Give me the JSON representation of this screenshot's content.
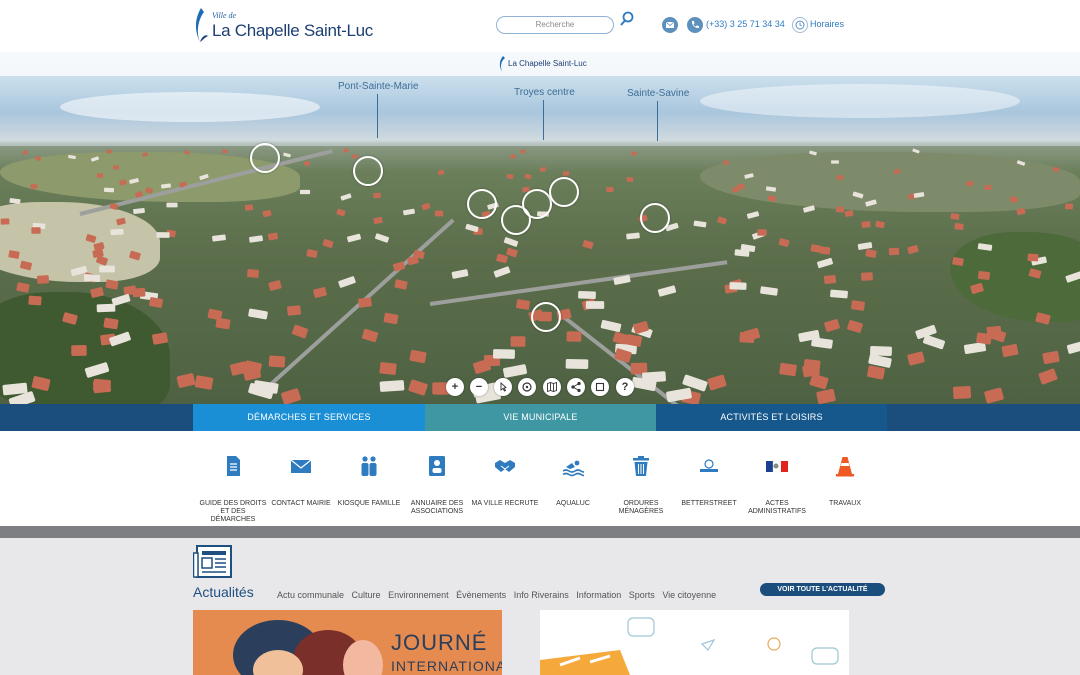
{
  "header": {
    "logo_small": "Ville de",
    "logo_main": "La Chapelle Saint-Luc",
    "search_placeholder": "Recherche",
    "phone": "(+33) 3 25 71 34 34",
    "hours_label": "Horaires"
  },
  "panorama": {
    "logo_text": "La Chapelle Saint-Luc",
    "places": [
      "Pont-Sainte-Marie",
      "Troyes centre",
      "Sainte-Savine"
    ],
    "controls": [
      "+",
      "−",
      "pointer",
      "rotate",
      "map",
      "share",
      "fullscreen",
      "?"
    ]
  },
  "tabs": [
    {
      "label": "Démarches et services"
    },
    {
      "label": "Vie municipale"
    },
    {
      "label": "Activités et loisirs"
    }
  ],
  "services": [
    {
      "label": "Guide des droits et des démarches",
      "icon": "document-icon"
    },
    {
      "label": "Contact mairie",
      "icon": "envelope-icon"
    },
    {
      "label": "Kiosque famille",
      "icon": "family-icon"
    },
    {
      "label": "Annuaire des associations",
      "icon": "directory-icon"
    },
    {
      "label": "Ma ville recrute",
      "icon": "handshake-icon"
    },
    {
      "label": "Aqualuc",
      "icon": "swimmer-icon"
    },
    {
      "label": "Ordures ménagères",
      "icon": "trash-icon"
    },
    {
      "label": "Betterstreet",
      "icon": "betterstreet-logo"
    },
    {
      "label": "Actes administratifs",
      "icon": "republic-logo"
    },
    {
      "label": "Travaux",
      "icon": "traffic-cone-icon"
    }
  ],
  "news": {
    "title": "Actualités",
    "categories": [
      "Actu communale",
      "Culture",
      "Environnement",
      "Évènements",
      "Info Riverains",
      "Information",
      "Sports",
      "Vie citoyenne"
    ],
    "all_label": "Voir toute l'actualité",
    "card1_line1": "JOURNÉ",
    "card1_line2": "INTERNATIONA"
  },
  "colors": {
    "primary": "#1b4d7d",
    "tab_active": "#1a8fd6",
    "tab_teal": "#3f97a4",
    "icon_blue": "#2f7bbf"
  }
}
